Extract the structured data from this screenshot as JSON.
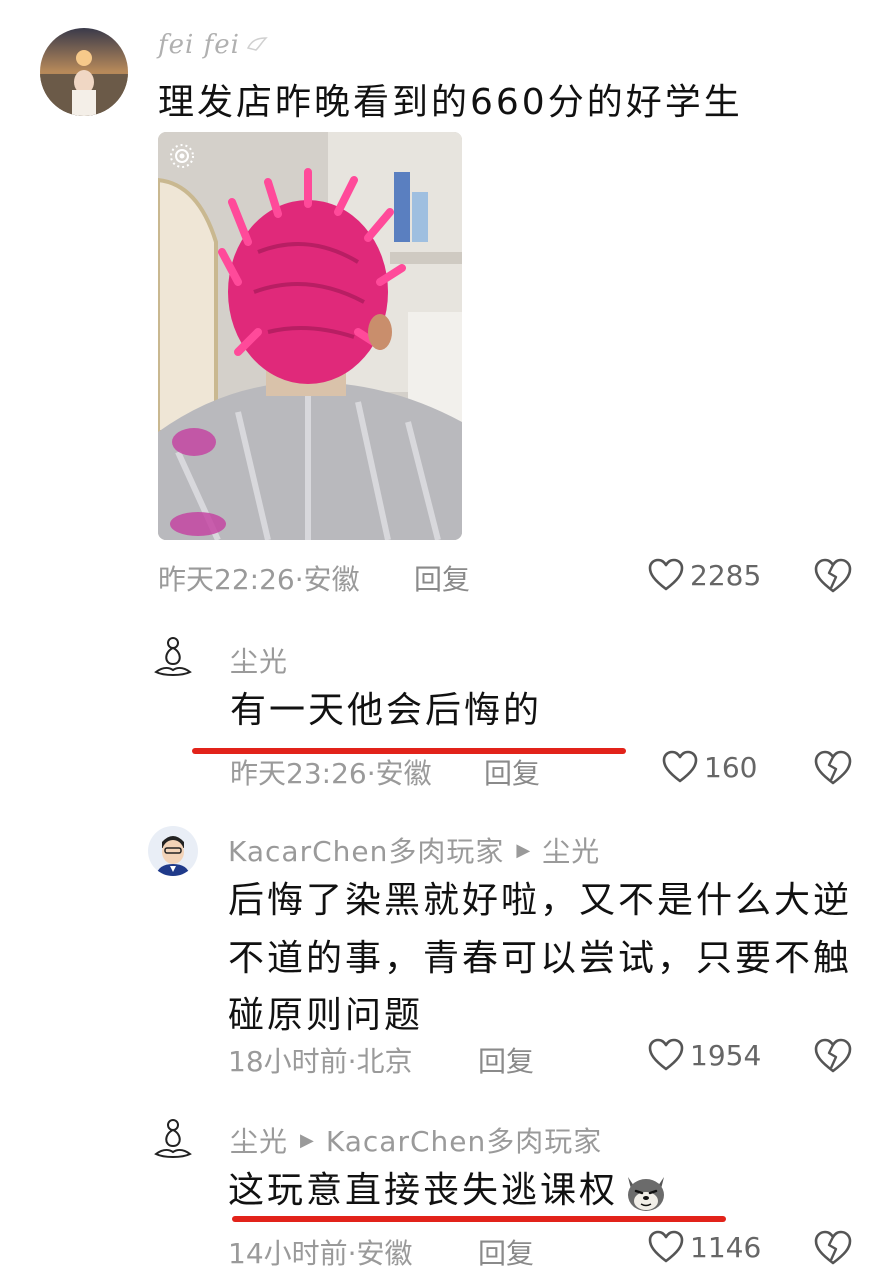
{
  "post": {
    "username": "fei fei",
    "text": "理发店昨晚看到的660分的好学生",
    "meta": "昨天22:26·安徽",
    "reply_label": "回复",
    "likes": "2285"
  },
  "comments": [
    {
      "username": "尘光",
      "text": "有一天他会后悔的",
      "meta": "昨天23:26·安徽",
      "reply_label": "回复",
      "likes": "160"
    },
    {
      "username": "KacarChen多肉玩家",
      "reply_to": "尘光",
      "text": "后悔了染黑就好啦，又不是什么大逆不道的事，青春可以尝试，只要不触碰原则问题",
      "meta": "18小时前·北京",
      "reply_label": "回复",
      "likes": "1954"
    },
    {
      "username": "尘光",
      "reply_to": "KacarChen多肉玩家",
      "text": "这玩意直接丧失逃课权",
      "meta": "14小时前·安徽",
      "reply_label": "回复",
      "likes": "1146"
    }
  ],
  "colors": {
    "underline": "#e2231a",
    "text": "#111111",
    "muted": "#9a9a9a",
    "hair": "#e0297a"
  },
  "icons": {
    "like": "heart-outline-icon",
    "dislike": "broken-heart-icon",
    "reply_arrow": "triangle-right-icon",
    "live_badge": "live-photo-icon",
    "emoji": "dog-face-emoji"
  }
}
